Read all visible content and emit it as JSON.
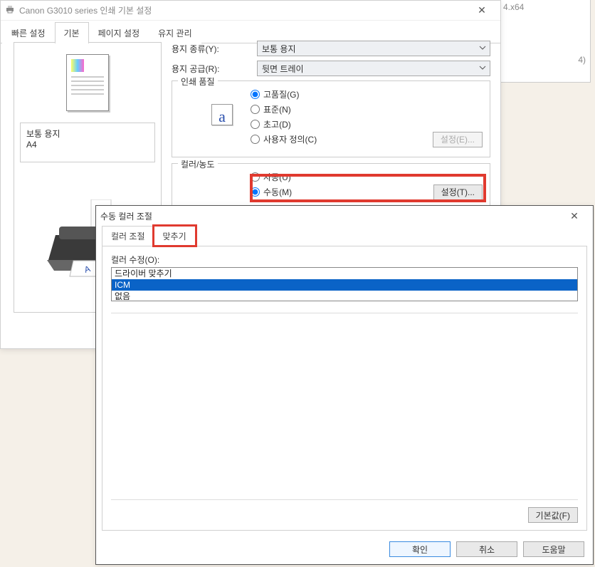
{
  "bg_text": "4.x64",
  "main": {
    "title": "Canon G3010 series 인쇄 기본 설정",
    "tabs": [
      "빠른 설정",
      "기본",
      "페이지 설정",
      "유지 관리"
    ],
    "active_tab": 1,
    "paper_type_label": "용지 종류(Y):",
    "paper_type_value": "보통 용지",
    "paper_source_label": "용지 공급(R):",
    "paper_source_value": "뒷면 트레이",
    "quality": {
      "legend": "인쇄 품질",
      "options": [
        "고품질(G)",
        "표준(N)",
        "초고(D)",
        "사용자 정의(C)"
      ],
      "selected": 0,
      "settings_btn": "설정(E)..."
    },
    "color": {
      "legend": "컬러/농도",
      "options": [
        "자동(U)",
        "수동(M)"
      ],
      "selected": 1,
      "settings_btn": "설정(T)..."
    },
    "preview": {
      "media": "보통 용지",
      "size": "A4"
    }
  },
  "color_dialog": {
    "title": "수동 컬러 조절",
    "tabs": [
      "컬러 조절",
      "맞추기"
    ],
    "active_tab": 1,
    "correction_label": "컬러 수정(O):",
    "options": [
      "드라이버 맞추기",
      "ICM",
      "없음"
    ],
    "selected": 1,
    "defaults_btn": "기본값(F)",
    "ok": "확인",
    "cancel": "취소",
    "help": "도움말"
  }
}
